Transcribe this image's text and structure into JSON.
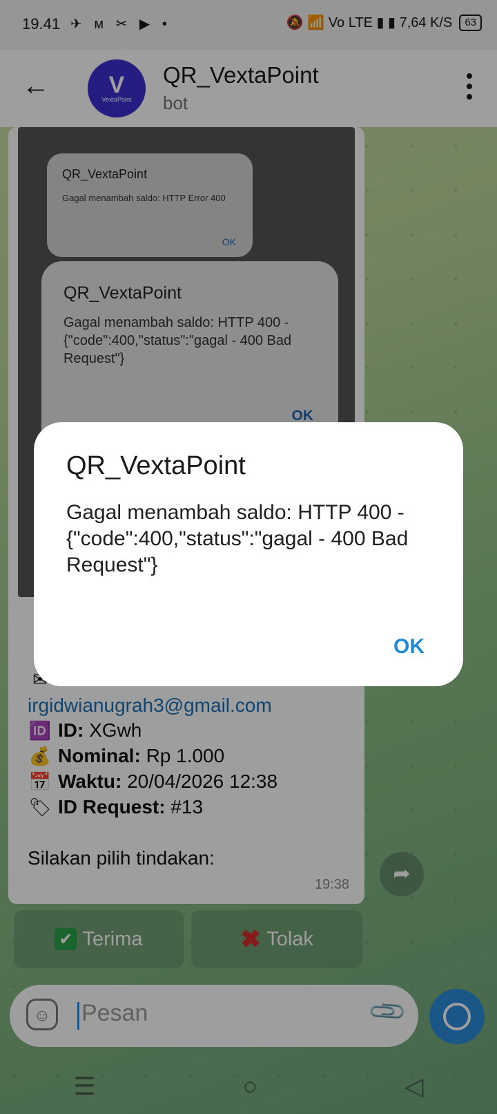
{
  "status_bar": {
    "time": "19.41",
    "app_icons": "✈ ᴍ ✂ ▶ •",
    "right_icons": "🔕 📶 Vo LTE ▮ ▮ 7,64 K/S",
    "battery": "63"
  },
  "header": {
    "back_icon": "←",
    "avatar_letter": "V",
    "avatar_text": "VextaPoint",
    "title": "QR_VextaPoint",
    "subtitle": "bot",
    "menu_icon": "more-vert-icon"
  },
  "screenshot_attachment": {
    "small_dialog": {
      "title": "QR_VextaPoint",
      "body": "Gagal menambah saldo: HTTP Error 400",
      "ok": "OK"
    },
    "large_dialog": {
      "title": "QR_VextaPoint",
      "body": "Gagal menambah saldo: HTTP 400 - {\"code\":400,\"status\":\"gagal - 400 Bad Request\"}",
      "ok": "OK"
    }
  },
  "message": {
    "email_label": "Email:",
    "email_value": "irgidwianugrah3@gmail.com",
    "id_label": "ID:",
    "id_value": "XGwh",
    "nominal_label": "Nominal:",
    "nominal_value": "Rp 1.000",
    "waktu_label": "Waktu:",
    "waktu_value": "20/04/2026 12:38",
    "request_label": "ID Request:",
    "request_value": "#13",
    "prompt": "Silakan pilih tindakan:",
    "time": "19:38"
  },
  "keyboard": {
    "accept_label": "Terima",
    "accept_icon": "✔",
    "reject_label": "Tolak",
    "reject_icon": "✖"
  },
  "input": {
    "placeholder": "Pesan"
  },
  "dialog": {
    "title": "QR_VextaPoint",
    "body": "Gagal menambah saldo: HTTP 400 - {\"code\":400,\"status\":\"gagal - 400 Bad Request\"}",
    "ok_label": "OK"
  },
  "nav": {
    "menu": "☰",
    "home": "○",
    "back": "◁"
  }
}
